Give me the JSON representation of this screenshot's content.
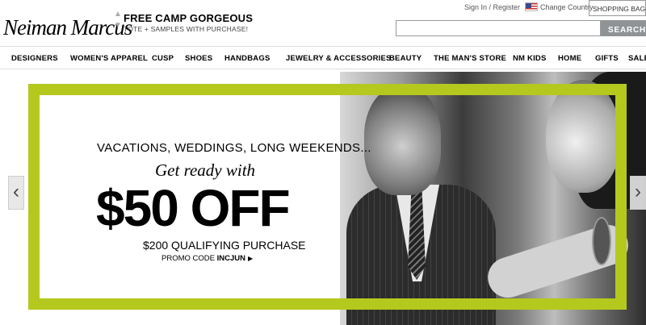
{
  "header": {
    "logo_text": "Neiman Marcus",
    "promo_title": "FREE CAMP GORGEOUS",
    "promo_subtitle": "TOTE + SAMPLES WITH PURCHASE!",
    "signin_register": "Sign In / Register",
    "change_country": "Change Country",
    "shopping_bag": "SHOPPING BAG",
    "search_placeholder": "",
    "search_button": "SEARCH"
  },
  "nav": {
    "items": [
      {
        "label": "DESIGNERS"
      },
      {
        "label": "WOMEN'S APPAREL"
      },
      {
        "label": "CUSP"
      },
      {
        "label": "SHOES"
      },
      {
        "label": "HANDBAGS"
      },
      {
        "label": "JEWELRY & ACCESSORIES"
      },
      {
        "label": "BEAUTY"
      },
      {
        "label": "THE MAN'S STORE"
      },
      {
        "label": "NM KIDS"
      },
      {
        "label": "HOME"
      },
      {
        "label": "GIFTS"
      },
      {
        "label": "SALE"
      }
    ]
  },
  "hero": {
    "line1": "VACATIONS, WEDDINGS, LONG WEEKENDS...",
    "line2": "Get ready with",
    "line3": "$50 OFF",
    "line4": "$200 QUALIFYING PURCHASE",
    "promo_label": "PROMO CODE",
    "promo_code": "INCJUN",
    "accent_color": "#b5c81e"
  },
  "icons": {
    "prev": "chevron-left-icon",
    "next": "chevron-right-icon",
    "flag": "us-flag-icon"
  }
}
